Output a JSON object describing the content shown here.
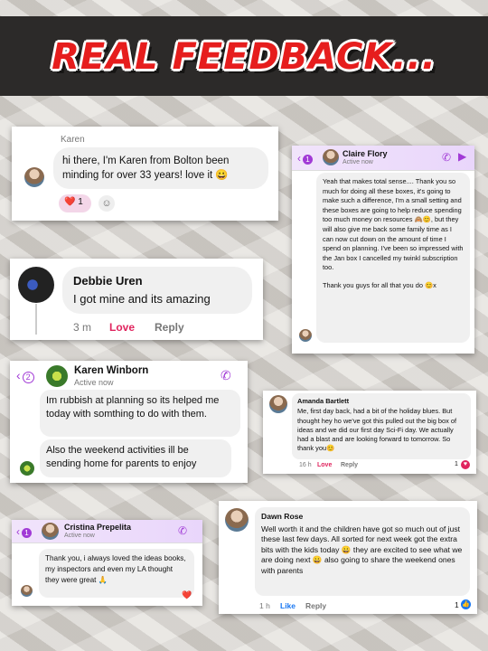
{
  "banner": {
    "title": "REAL FEEDBACK..."
  },
  "karen": {
    "name": "Karen",
    "message": "hi there, I'm Karen from Bolton been minding for over 33 years! love it 😀",
    "reaction": "❤️",
    "reaction_count": "1"
  },
  "claire": {
    "back_count": "1",
    "name": "Claire Flory",
    "status": "Active now",
    "message": "Yeah that makes total sense.... Thank you so much for doing all these boxes, it's going to make such a difference, I'm a small setting and these boxes are going to help reduce spending too much money on resources 🙈😊, but they will also give me back some family time as I can now cut down on the amount of time I spend on planning. I've been so impressed with the Jan box I cancelled my twinkl subscription too.",
    "message2": "Thank you guys for all that you do 😊x"
  },
  "debbie": {
    "name": "Debbie Uren",
    "message": "I got mine and its amazing",
    "time": "3 m",
    "love": "Love",
    "reply": "Reply"
  },
  "karenw": {
    "back_count": "2",
    "name": "Karen Winborn",
    "status": "Active now",
    "message1": "Im rubbish at planning so its helped me today with somthing to do with them.",
    "message2": "Also the weekend activities ill be sending home for parents to enjoy"
  },
  "amanda": {
    "name": "Amanda Bartlett",
    "message": "Me, first day back, had a bit of the holiday blues. But thought hey ho we've got this pulled out the big box of ideas and we did our first day Sci-Fi day. We actually had a blast and are looking forward to tomorrow. So thank you😊",
    "time": "16 h",
    "love": "Love",
    "reply": "Reply",
    "reaction_count": "1"
  },
  "cristina": {
    "back_count": "1",
    "name": "Cristina Prepelita",
    "status": "Active now",
    "message": "Thank you, i always loved the ideas books, my inspectors and even my LA thought they were great 🙏",
    "reaction": "❤️"
  },
  "dawn": {
    "name": "Dawn Rose",
    "message": "Well worth it and the children have got so much out of just these last few days. All sorted for next week got the extra bits with the kids today 😀 they are excited to see what we are doing next 😀 also going to share the weekend ones with parents",
    "time": "1 h",
    "like": "Like",
    "reply": "Reply",
    "reaction_count": "1"
  },
  "colors": {
    "messenger_purple": "#a13ad6",
    "love_red": "#e0245e",
    "like_blue": "#1877f2",
    "banner_bg": "#2c2a29",
    "title_red": "#e61d1d"
  }
}
